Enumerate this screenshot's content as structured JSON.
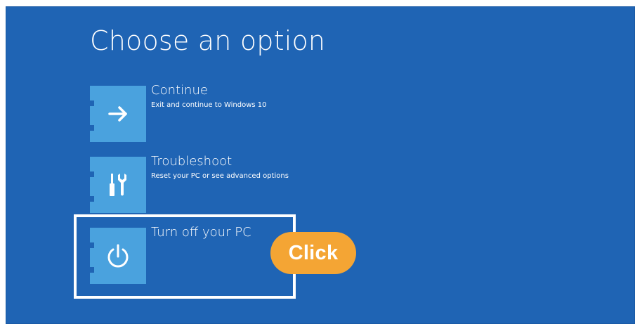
{
  "screen": {
    "title": "Choose an option",
    "background_color": "#1f64b4",
    "tile_color": "#4aa2de"
  },
  "options": [
    {
      "label": "Continue",
      "description": "Exit and continue to Windows 10",
      "icon": "arrow-right-icon"
    },
    {
      "label": "Troubleshoot",
      "description": "Reset your PC or see advanced options",
      "icon": "tools-icon"
    },
    {
      "label": "Turn off your PC",
      "description": "",
      "icon": "power-icon"
    }
  ],
  "annotation": {
    "click_label": "Click",
    "badge_color": "#f4a534",
    "highlight_target": "Turn off your PC"
  }
}
